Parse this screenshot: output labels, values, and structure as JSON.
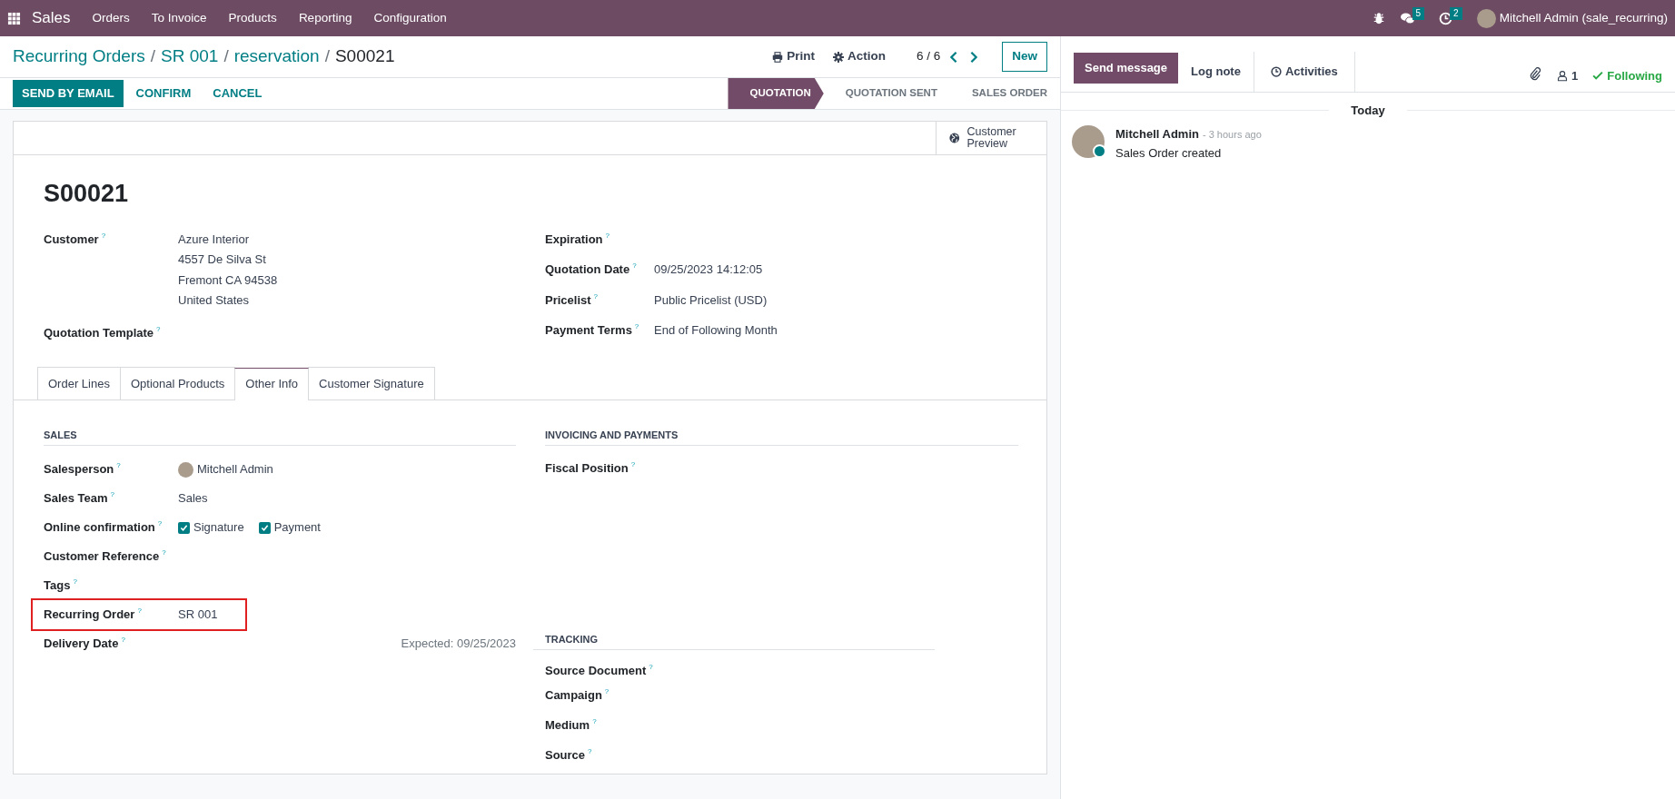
{
  "navbar": {
    "app": "Sales",
    "menu": [
      "Orders",
      "To Invoice",
      "Products",
      "Reporting",
      "Configuration"
    ],
    "messages_count": "5",
    "activities_count": "2",
    "user": "Mitchell Admin (sale_recurring)"
  },
  "breadcrumbs": [
    "Recurring Orders",
    "SR 001",
    "reservation"
  ],
  "breadcrumb_separator": "/",
  "current_record": "S00021",
  "control_panel": {
    "print": "Print",
    "action": "Action",
    "pager": "6 / 6",
    "new": "New"
  },
  "status_buttons": [
    {
      "label": "SEND BY EMAIL",
      "primary": true
    },
    {
      "label": "CONFIRM",
      "primary": false
    },
    {
      "label": "CANCEL",
      "primary": false
    }
  ],
  "stages": [
    {
      "label": "QUOTATION",
      "selected": true
    },
    {
      "label": "QUOTATION SENT",
      "selected": false
    },
    {
      "label": "SALES ORDER",
      "selected": false
    }
  ],
  "smart_button": "Customer Preview",
  "title": "S00021",
  "left_fields": [
    {
      "label": "Customer",
      "help": "?",
      "lines": [
        "Azure Interior",
        "4557 De Silva St",
        "Fremont CA 94538",
        "United States"
      ]
    },
    {
      "label": "Quotation Template",
      "help": "?"
    }
  ],
  "right_fields": [
    {
      "label": "Expiration",
      "help": "?"
    },
    {
      "label": "Quotation Date",
      "help": "?",
      "lines": [
        "09/25/2023 14:12:05"
      ]
    },
    {
      "label": "Pricelist",
      "help": "?",
      "lines": [
        "Public Pricelist (USD)"
      ]
    },
    {
      "label": "Payment Terms",
      "help": "?",
      "lines": [
        "End of Following Month"
      ]
    }
  ],
  "tabs": [
    {
      "label": "Order Lines",
      "selected": false
    },
    {
      "label": "Optional Products",
      "selected": false
    },
    {
      "label": "Other Info",
      "selected": true
    },
    {
      "label": "Customer Signature",
      "selected": false
    }
  ],
  "sales_section": {
    "title": "SALES",
    "fields": [
      {
        "kind": "user",
        "label": "Salesperson",
        "help": "?",
        "value": "Mitchell Admin",
        "highlighted": false
      },
      {
        "kind": "text",
        "label": "Sales Team",
        "help": "?",
        "value": "Sales",
        "highlighted": false
      },
      {
        "kind": "checkboxes",
        "label": "Online confirmation",
        "help": "?",
        "options": [
          {
            "label": "Signature",
            "checked": true
          },
          {
            "label": "Payment",
            "checked": true
          }
        ],
        "highlighted": false
      },
      {
        "kind": "text",
        "label": "Customer Reference",
        "help": "?",
        "highlighted": false
      },
      {
        "kind": "text",
        "label": "Tags",
        "help": "?",
        "highlighted": false
      },
      {
        "kind": "text",
        "label": "Recurring Order",
        "help": "?",
        "value": "SR 001",
        "highlighted": true
      },
      {
        "kind": "hint",
        "label": "Delivery Date",
        "help": "?",
        "value": "Expected: 09/25/2023",
        "highlighted": false
      }
    ]
  },
  "invoicing_section": {
    "title": "INVOICING AND PAYMENTS",
    "fields": [
      {
        "label": "Fiscal Position",
        "help": "?"
      }
    ]
  },
  "tracking_section": {
    "title": "TRACKING",
    "fields": [
      {
        "label": "Source Document",
        "help": "?"
      },
      {
        "label": "Campaign",
        "help": "?"
      },
      {
        "label": "Medium",
        "help": "?"
      },
      {
        "label": "Source",
        "help": "?"
      }
    ]
  },
  "chatter": {
    "send_message": "Send message",
    "log_note": "Log note",
    "activities": "Activities",
    "followers_count": "1",
    "following": "Following",
    "date_separator": "Today",
    "messages": [
      {
        "author": "Mitchell Admin",
        "time": "- 3 hours ago",
        "body": "Sales Order created",
        "online": true
      }
    ]
  }
}
